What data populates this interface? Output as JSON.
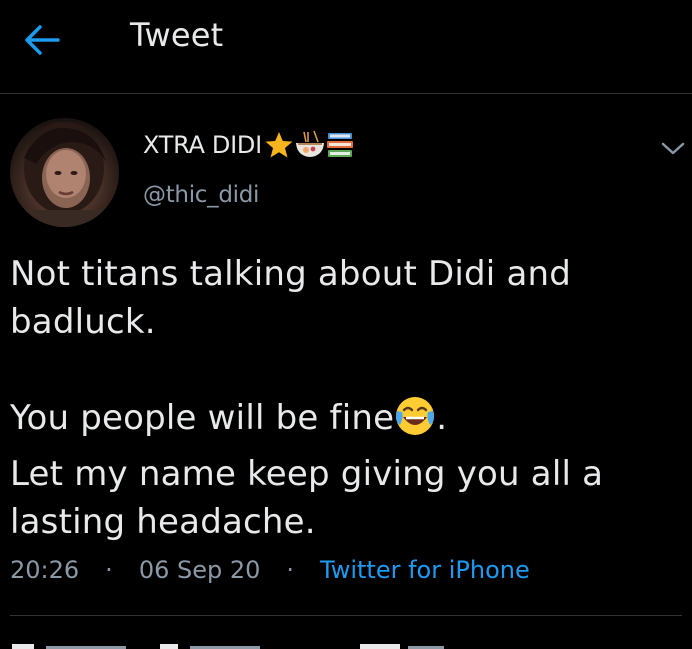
{
  "header": {
    "title": "Tweet",
    "back_icon": "arrow-left-icon",
    "accent_color": "#1d9bf0"
  },
  "author": {
    "display_name": "XTRA DIDI",
    "name_emojis": [
      "star-icon",
      "ramen-bowl-icon",
      "books-icon"
    ],
    "handle": "@thic_didi",
    "avatar_icon": "profile-photo"
  },
  "tweet": {
    "lines": [
      "Not titans talking about Didi and",
      "badluck.",
      "",
      "You people will be fine",
      "Let my name keep giving you all a",
      "lasting headache."
    ],
    "line4_suffix": ".",
    "line4_emoji": "face-with-tears-of-joy-icon"
  },
  "meta": {
    "time": "20:26",
    "separator": "·",
    "date": "06 Sep 20",
    "source": "Twitter for iPhone"
  },
  "more_icon": "chevron-down-icon"
}
